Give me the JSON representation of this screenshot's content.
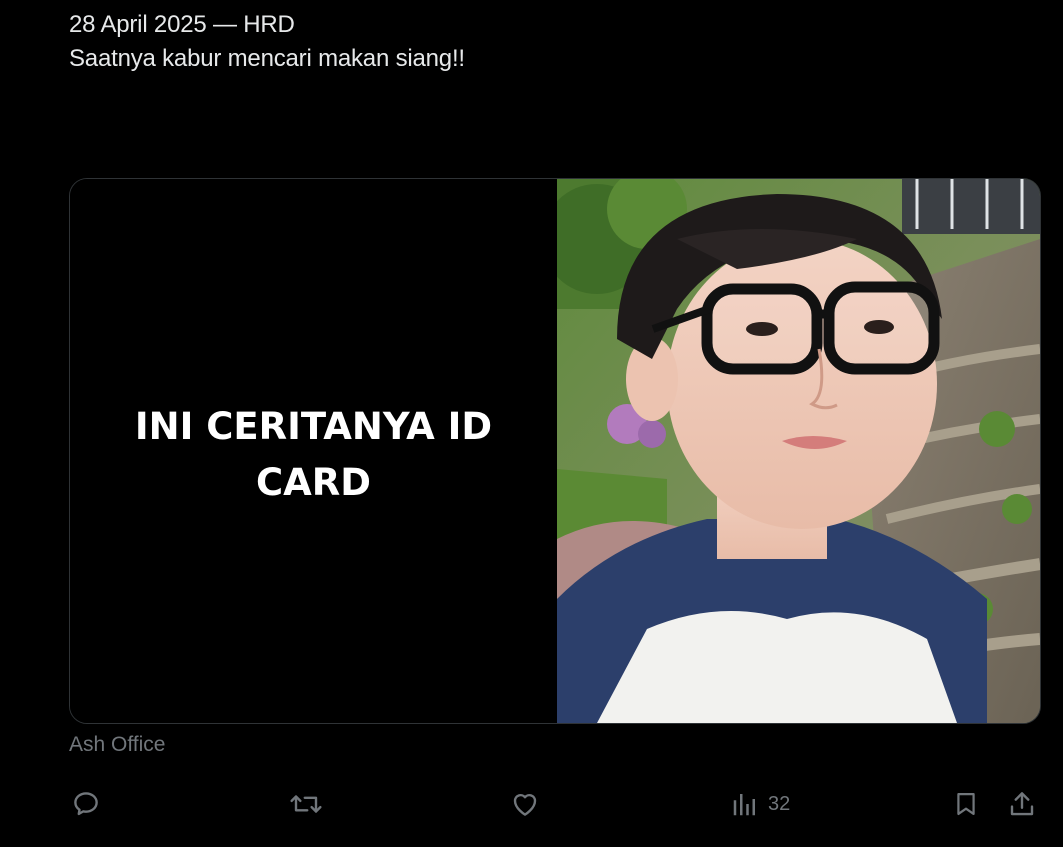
{
  "tweet": {
    "line1": "28 April 2025 — HRD",
    "line2": "Saatnya kabur mencari makan siang!!"
  },
  "card": {
    "caption": "INI CERITANYA ID CARD"
  },
  "attribution": "Ash Office",
  "actions": {
    "reply_icon": "reply-icon",
    "retweet_icon": "retweet-icon",
    "like_icon": "heart-icon",
    "views_icon": "bar-chart-icon",
    "views_count": "32",
    "bookmark_icon": "bookmark-icon",
    "share_icon": "share-icon"
  },
  "colors": {
    "background": "#000000",
    "text_primary": "#e7e9ea",
    "text_secondary": "#71767b",
    "border": "#2f3336"
  }
}
